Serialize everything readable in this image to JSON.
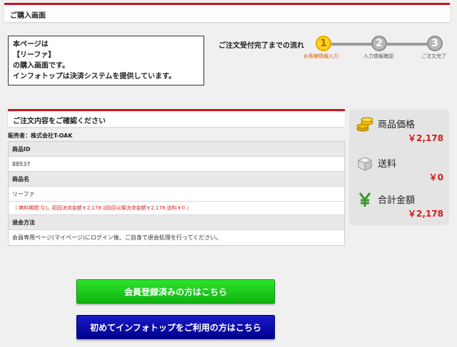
{
  "header": {
    "title": "ご購入画面"
  },
  "notice": {
    "lines": [
      "本ページは",
      "【リーファ】",
      "の購入画面です。",
      "インフォトップは決済システムを提供しています。"
    ]
  },
  "flow": {
    "title": "ご注文受付完了までの流れ",
    "steps": [
      {
        "number": "1",
        "label": "お客様情報入力"
      },
      {
        "number": "2",
        "label": "入力情報確認"
      },
      {
        "number": "3",
        "label": "ご注文完了"
      }
    ]
  },
  "order": {
    "section_title": "ご注文内容をご確認ください",
    "seller": "販売者：株式会社T-OAK",
    "product_id_label": "商品ID",
    "product_id": "88537",
    "product_name_label": "商品名",
    "product_name": "リーファ",
    "payment_note": "（ 無料期間 なし  初回決済金額￥2,178  2回目以降決済金額￥2,178  送料￥0 ）",
    "cancel_label": "退会方法",
    "cancel_text": "会員専用ページ(マイページ)にログイン後、ご自身で退会処理を行ってください。"
  },
  "summary": {
    "price_label": "商品価格",
    "price": "￥2,178",
    "shipping_label": "送料",
    "shipping": "￥0",
    "total_label": "合計金額",
    "total": "￥2,178"
  },
  "buttons": {
    "member": "会員登録済みの方はこちら",
    "new_user": "初めてインフォトップをご利用の方はこちら"
  }
}
